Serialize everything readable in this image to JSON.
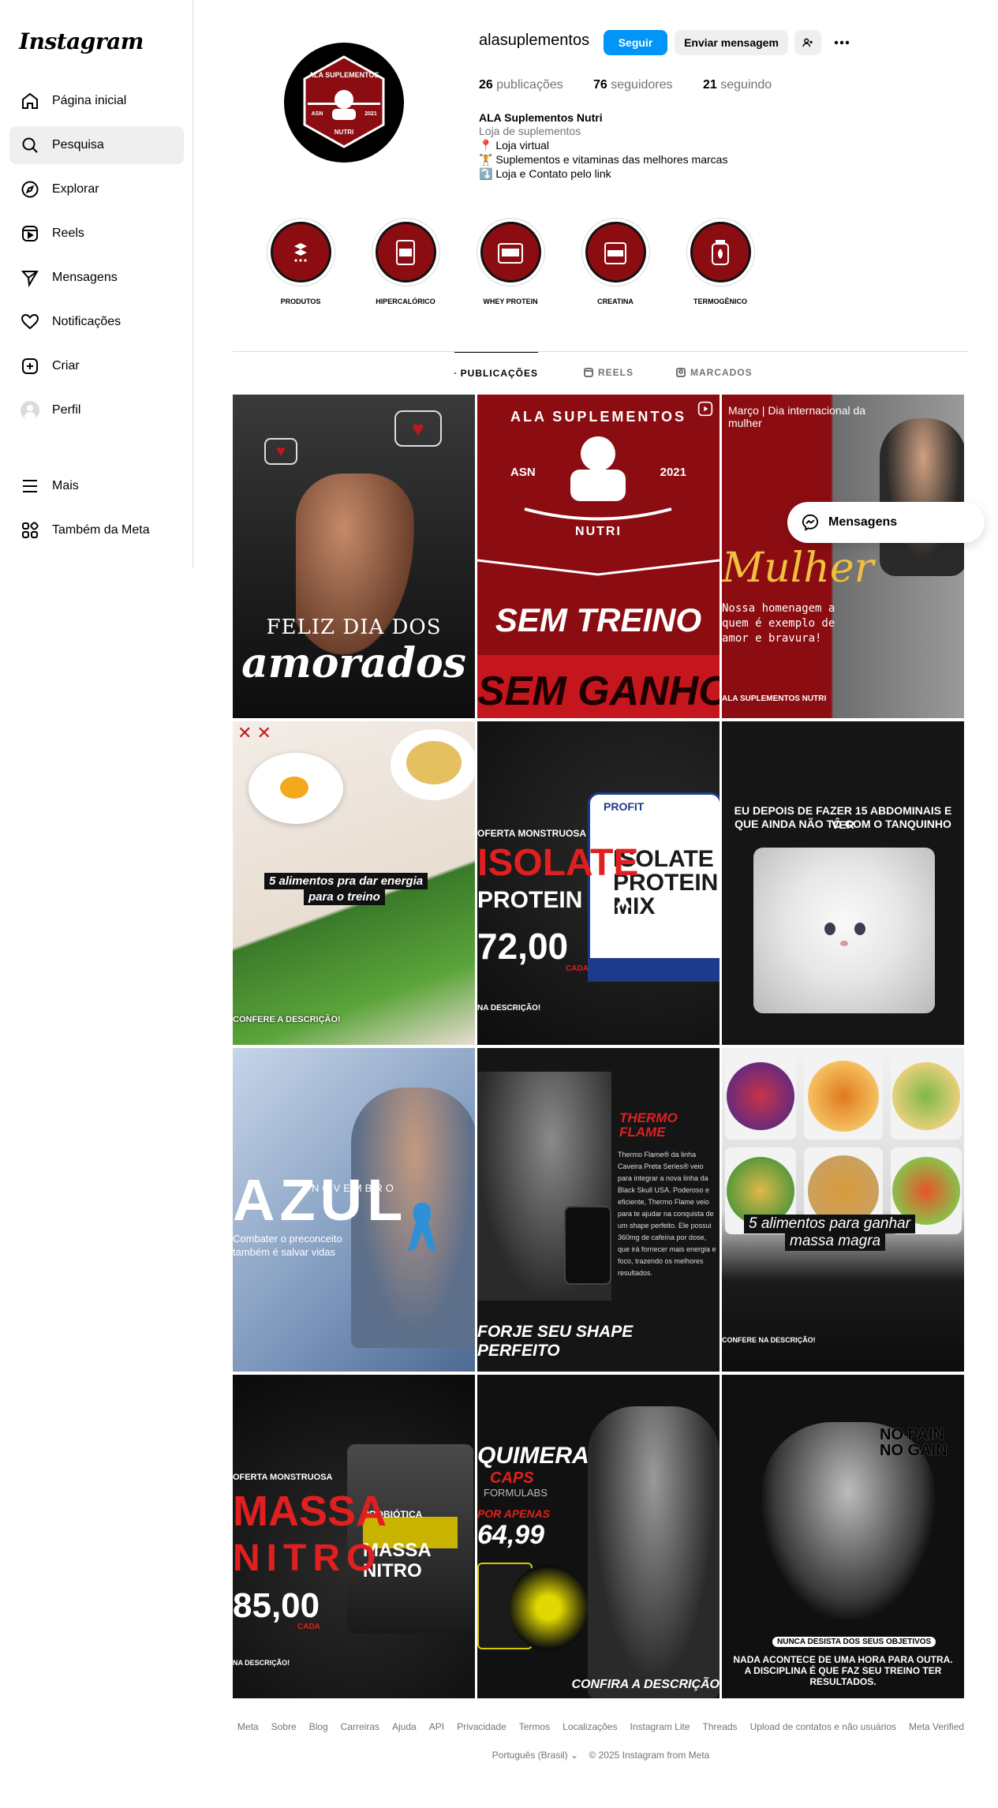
{
  "app": {
    "logo": "Instagram"
  },
  "sidebar": {
    "items": [
      {
        "label": "Página inicial",
        "icon": "home-icon"
      },
      {
        "label": "Pesquisa",
        "icon": "search-icon",
        "active": true
      },
      {
        "label": "Explorar",
        "icon": "compass-icon"
      },
      {
        "label": "Reels",
        "icon": "reels-icon"
      },
      {
        "label": "Mensagens",
        "icon": "direct-icon"
      },
      {
        "label": "Notificações",
        "icon": "heart-icon"
      },
      {
        "label": "Criar",
        "icon": "plus-square-icon"
      },
      {
        "label": "Perfil",
        "icon": "avatar"
      },
      {
        "label": "Mais",
        "icon": "menu-icon"
      },
      {
        "label": "Também da Meta",
        "icon": "meta-apps-icon"
      }
    ]
  },
  "profile": {
    "username": "alasuplementos",
    "follow_label": "Seguir",
    "message_label": "Enviar mensagem",
    "stats": {
      "posts_count": "26",
      "posts_label": "publicações",
      "followers_count": "76",
      "followers_label": "seguidores",
      "following_count": "21",
      "following_label": "seguindo"
    },
    "bio": {
      "name": "ALA Suplementos Nutri",
      "category": "Loja de suplementos",
      "lines": [
        "📍 Loja virtual",
        "🏋 Suplementos e vitaminas das melhores marcas",
        "⤵️ Loja e Contato pelo link"
      ]
    },
    "logo_text": {
      "top": "ALA SUPLEMENTOS",
      "left": "ASN",
      "right": "2021",
      "bottom": "NUTRI"
    }
  },
  "highlights": [
    {
      "label": "PRODUTOS"
    },
    {
      "label": "HIPERCALÓRICO"
    },
    {
      "label": "WHEY PROTEIN"
    },
    {
      "label": "CREATINA"
    },
    {
      "label": "TERMOGÊNICO"
    }
  ],
  "tabs": [
    {
      "label": "PUBLICAÇÕES",
      "active": true
    },
    {
      "label": "REELS"
    },
    {
      "label": "MARCADOS"
    }
  ],
  "posts": [
    {
      "lines": [
        "FELIZ DIA DOS",
        "amorados"
      ]
    },
    {
      "lines": [
        "ALA SUPLEMENTOS",
        "ASN",
        "2021",
        "NUTRI",
        "SEM TREINO",
        "SEM GANHO"
      ]
    },
    {
      "lines": [
        "Março | Dia internacional da mulher",
        "Mulher",
        "Nossa homenagem a quem é exemplo de amor e bravura!",
        "ALA SUPLEMENTOS NUTRI"
      ]
    },
    {
      "lines": [
        "5 alimentos pra dar energia",
        "para o treino",
        "CONFERE A DESCRIÇÃO!"
      ]
    },
    {
      "lines": [
        "OFERTA MONSTRUOSA",
        "ISOLATE",
        "PROTEIN MIX",
        "72,00",
        "CADA",
        "NA DESCRIÇÃO!",
        "PROFIT",
        "ISOLATE PROTEIN MIX"
      ]
    },
    {
      "lines": [
        "EU DEPOIS DE FAZER 15 ABDOMINAIS E VER",
        "QUE AINDA NÃO TÔ COM O TANQUINHO"
      ]
    },
    {
      "lines": [
        "AZUL",
        "NOVEMBRO",
        "Combater o preconceito",
        "também é salvar vidas"
      ]
    },
    {
      "lines": [
        "THERMO FLAME",
        "Thermo Flame® da linha Caveira Preta Series® veio para integrar a nova linha da Black Skull USA. Poderoso e eficiente, Thermo Flame veio para te ajudar na conquista de um shape perfeito. Ele possui 360mg de cafeína por dose, que irá fornecer mais energia e foco, trazendo os melhores resultados.",
        "FORJE SEU SHAPE",
        "PERFEITO"
      ]
    },
    {
      "lines": [
        "5 alimentos para ganhar",
        "massa magra",
        "CONFERE NA DESCRIÇÃO!"
      ]
    },
    {
      "lines": [
        "OFERTA MONSTRUOSA",
        "MASSA",
        "NITRO",
        "85,00",
        "CADA",
        "NA DESCRIÇÃO!",
        "PROBIÓTICA",
        "MASSA NITRO"
      ]
    },
    {
      "lines": [
        "QUIMERA",
        "CAPS",
        "FORMULABS",
        "POR APENAS",
        "64,99",
        "CONFIRA A DESCRIÇÃO"
      ]
    },
    {
      "lines": [
        "NO PAIN",
        "NO GAIN",
        "NUNCA DESISTA DOS SEUS OBJETIVOS",
        "NADA ACONTECE DE UMA HORA PARA OUTRA.",
        "A DISCIPLINA É QUE FAZ SEU TREINO TER",
        "RESULTADOS."
      ]
    }
  ],
  "messages_pill": {
    "label": "Mensagens"
  },
  "footer": {
    "links": [
      "Meta",
      "Sobre",
      "Blog",
      "Carreiras",
      "Ajuda",
      "API",
      "Privacidade",
      "Termos",
      "Localizações",
      "Instagram Lite",
      "Threads",
      "Upload de contatos e não usuários",
      "Meta Verified"
    ],
    "language": "Português (Brasil)",
    "copyright": "© 2025 Instagram from Meta"
  },
  "colors": {
    "brand_red": "#8b0d12",
    "follow_blue": "#0095f6",
    "muted": "#737373"
  }
}
